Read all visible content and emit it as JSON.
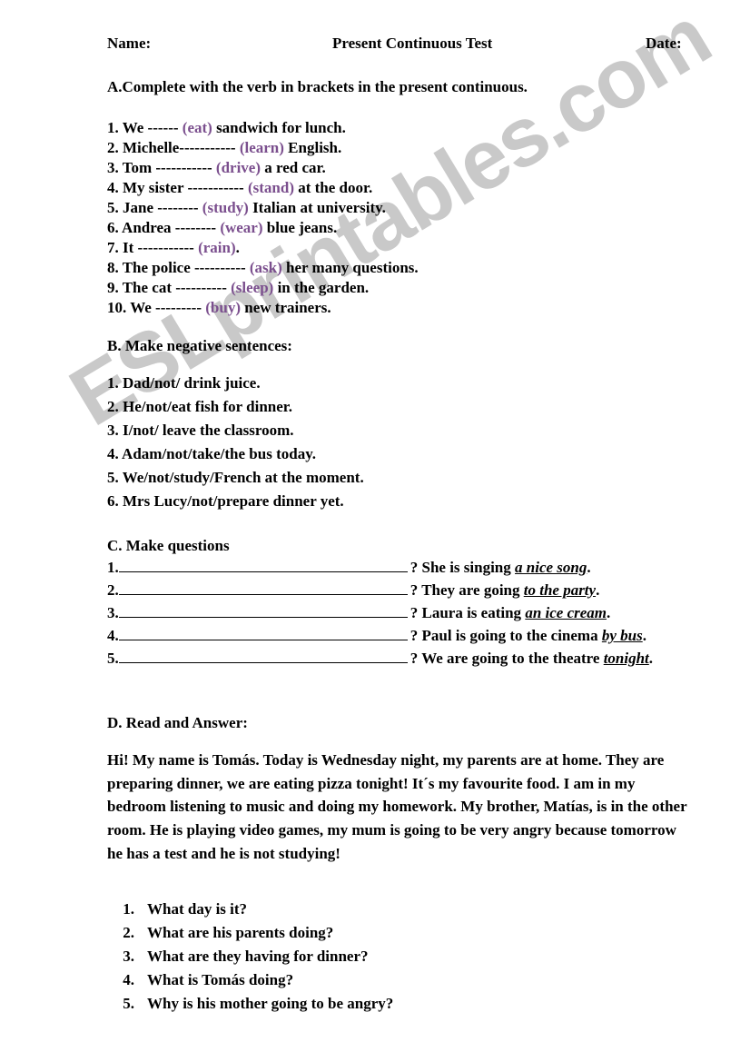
{
  "header": {
    "name_label": "Name:",
    "title": "Present Continuous Test",
    "date_label": "Date:"
  },
  "watermark": {
    "text": "ESLprintables.com",
    "color": "#c9c9c9"
  },
  "colors": {
    "verb_hint": "#7b4f8e",
    "text": "#000000",
    "background": "#ffffff"
  },
  "sectionA": {
    "heading": "A.Complete with the verb in brackets in the present continuous.",
    "items": [
      {
        "number": "1.",
        "before": " We ------ ",
        "verb": "(eat)",
        "after": " sandwich for lunch."
      },
      {
        "number": "2.",
        "before": " Michelle----------- ",
        "verb": "(learn)",
        "after": " English."
      },
      {
        "number": "3.",
        "before": " Tom ----------- ",
        "verb": "(drive)",
        "after": " a red car."
      },
      {
        "number": "4.",
        "before": " My sister ----------- ",
        "verb": "(stand)",
        "after": " at the door."
      },
      {
        "number": "5.",
        "before": " Jane -------- ",
        "verb": "(study)",
        "after": " Italian at university."
      },
      {
        "number": "6.",
        "before": " Andrea -------- ",
        "verb": "(wear)",
        "after": "  blue jeans."
      },
      {
        "number": "7.",
        "before": " It ----------- ",
        "verb": "(rain)",
        "after": "."
      },
      {
        "number": "8.",
        "before": " The police ---------- ",
        "verb": "(ask)",
        "after": " her many questions."
      },
      {
        "number": "9.",
        "before": " The cat ---------- ",
        "verb": "(sleep)",
        "after": " in the garden."
      },
      {
        "number": "10.",
        "before": " We --------- ",
        "verb": "(buy)",
        "after": " new trainers."
      }
    ]
  },
  "sectionB": {
    "heading": "B. Make negative sentences:",
    "items": [
      "1. Dad/not/ drink juice.",
      "2. He/not/eat fish for dinner.",
      "3. I/not/ leave the classroom.",
      "4. Adam/not/take/the bus today.",
      "5. We/not/study/French at the moment.",
      "6. Mrs Lucy/not/prepare dinner yet."
    ]
  },
  "sectionC": {
    "heading": "C. Make questions",
    "rows": [
      {
        "number": "1.",
        "answer_prefix": "? She is singing ",
        "phrase": "a nice song",
        "answer_suffix": "."
      },
      {
        "number": "2.",
        "answer_prefix": "? They are going ",
        "phrase": "to the party",
        "answer_suffix": "."
      },
      {
        "number": "3.",
        "answer_prefix": "? Laura is eating ",
        "phrase": "an ice cream",
        "answer_suffix": "."
      },
      {
        "number": "4.",
        "answer_prefix": "? Paul is going to the cinema ",
        "phrase": "by bus",
        "answer_suffix": "."
      },
      {
        "number": "5.",
        "answer_prefix": "? We are going to the theatre ",
        "phrase": "tonight",
        "answer_suffix": "."
      }
    ]
  },
  "sectionD": {
    "heading": "D. Read and Answer:",
    "passage": "Hi! My name is Tomás. Today is Wednesday night, my parents are at home. They are preparing dinner, we are eating pizza tonight! It´s my favourite food. I am in my bedroom listening to music and doing my homework. My brother, Matías, is in the other room. He is playing video games, my mum is going to be very angry because tomorrow he has a test and he is not studying!",
    "questions": [
      {
        "number": "1.",
        "text": "What day is it?"
      },
      {
        "number": "2.",
        "text": "What are his parents doing?"
      },
      {
        "number": "3.",
        "text": "What are they having for dinner?"
      },
      {
        "number": "4.",
        "text": "What is Tomás doing?"
      },
      {
        "number": "5.",
        "text": "Why is his mother going to be angry?"
      }
    ]
  }
}
